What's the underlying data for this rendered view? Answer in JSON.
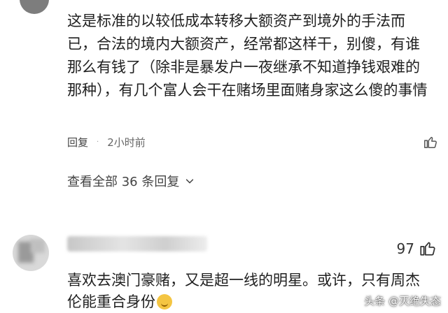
{
  "comment1": {
    "text": "这是标准的以较低成本转移大额资产到境外的手法而已，合法的境内大额资产，经常都这样干，别傻，有谁那么有钱了（除非是暴发户一夜继承不知道挣钱艰难的那种），有几个富人会干在赌场里面赌身家这么傻的事情",
    "reply_label": "回复",
    "separator": "·",
    "time": "2小时前",
    "view_replies": "查看全部 36 条回复"
  },
  "comment2": {
    "like_count": "97",
    "text": "喜欢去澳门豪赌，又是超一线的明星。或许，只有周杰伦能重合身份"
  },
  "watermark": "头条 @灭绝失态",
  "icons": {
    "like": "thumbs-up-icon",
    "chevron": "chevron-down-icon",
    "emoji": "smirk-emoji-icon"
  }
}
